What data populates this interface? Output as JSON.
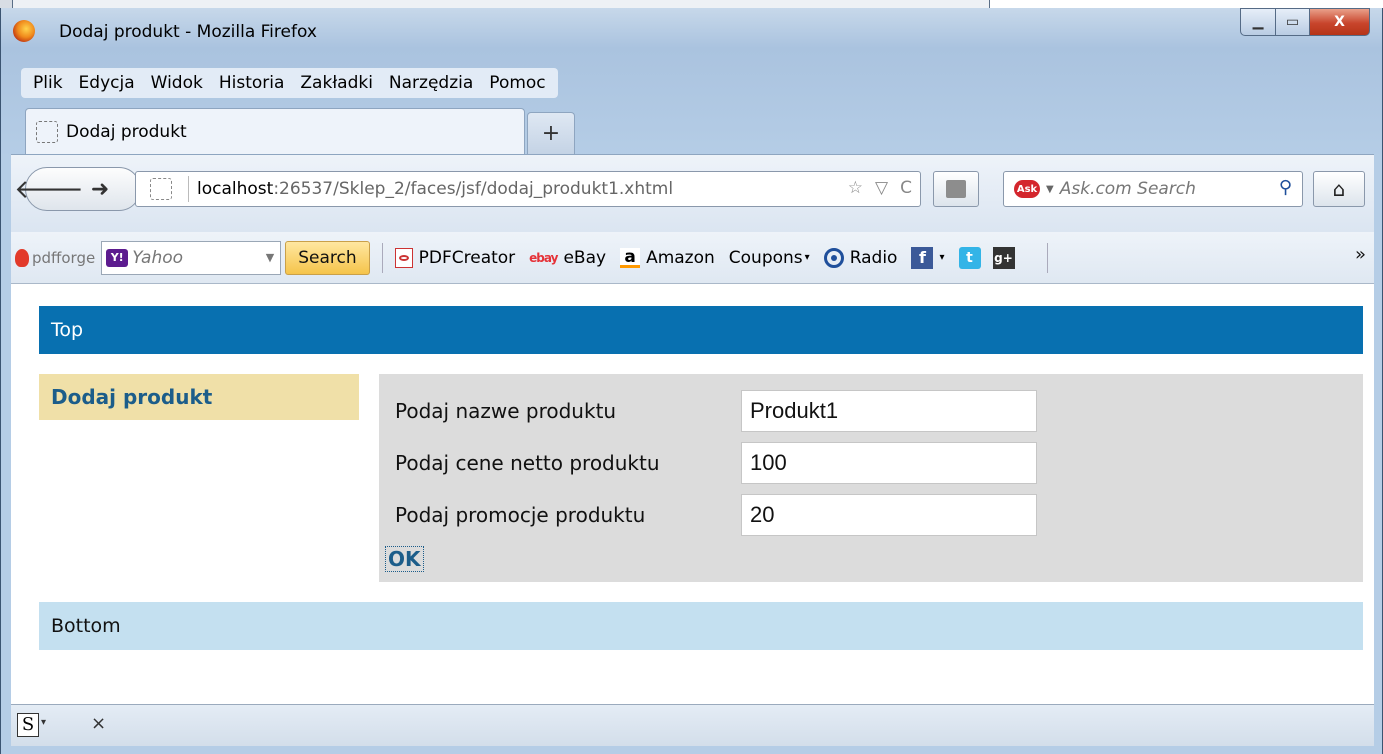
{
  "window": {
    "title": "Dodaj produkt - Mozilla Firefox",
    "controls": {
      "minimize": "—",
      "maximize": "▫",
      "close": "X"
    }
  },
  "menu": {
    "items": [
      {
        "label": "Plik"
      },
      {
        "label": "Edycja"
      },
      {
        "label": "Widok"
      },
      {
        "label": "Historia"
      },
      {
        "label": "Zakładki"
      },
      {
        "label": "Narzędzia"
      },
      {
        "label": "Pomoc"
      }
    ]
  },
  "tabs": {
    "active_label": "Dodaj produkt",
    "new_tab": "+"
  },
  "nav": {
    "url_host": "localhost",
    "url_rest": ":26537/Sklep_2/faces/jsf/dodaj_produkt1.xhtml",
    "search_placeholder": "Ask.com Search",
    "search_engine_icon": "Ask"
  },
  "toolbar": {
    "pdfforge": "pdfforge",
    "yahoo_placeholder": "Yahoo",
    "search_button": "Search",
    "bookmarks": [
      {
        "label": "PDFCreator",
        "icon": "pdf-icon"
      },
      {
        "label": "eBay",
        "icon": "ebay-icon"
      },
      {
        "label": "Amazon",
        "icon": "amazon-icon"
      },
      {
        "label": "Coupons",
        "icon": ""
      },
      {
        "label": "Radio",
        "icon": "radio-icon"
      }
    ],
    "overflow": "»"
  },
  "page": {
    "top_label": "Top",
    "left_heading": "Dodaj produkt",
    "form": {
      "name_label": "Podaj nazwe produktu",
      "name_value": "Produkt1",
      "price_label": "Podaj cene netto produktu",
      "price_value": "100",
      "promo_label": "Podaj promocje produktu",
      "promo_value": "20",
      "submit_label": "OK"
    },
    "bottom_label": "Bottom"
  },
  "addon_bar": {
    "close": "×"
  },
  "colors": {
    "top_bar": "#0870b0",
    "left_panel": "#f0e0a8",
    "form_panel": "#dcdcdc",
    "bottom_bar": "#c4e0f0",
    "link": "#1c5d8a"
  }
}
